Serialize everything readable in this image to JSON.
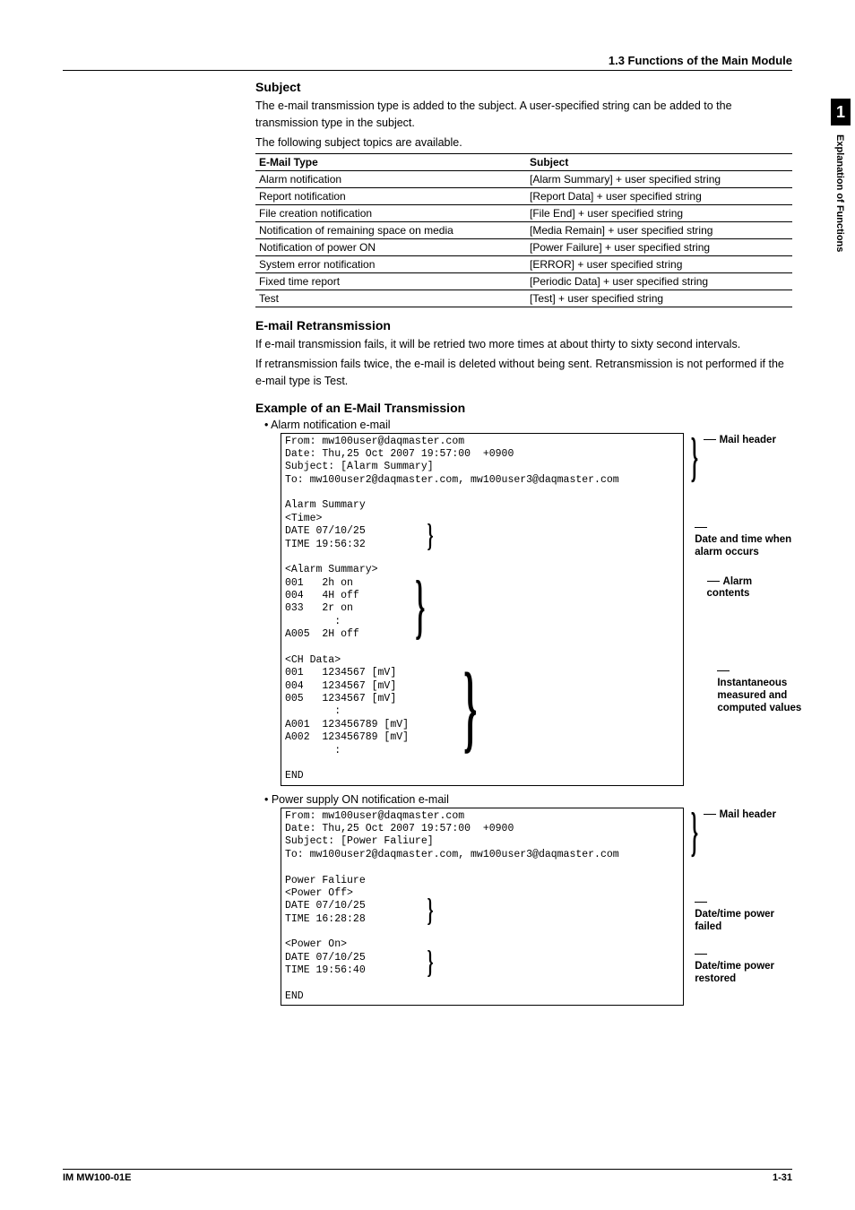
{
  "header": {
    "section": "1.3  Functions of the Main Module"
  },
  "sidetab": {
    "num": "1",
    "label": "Explanation of Functions"
  },
  "subject": {
    "title": "Subject",
    "p1": "The e-mail transmission type is added to the subject. A user-specified string can be added to the transmission type in the subject.",
    "p2": "The following subject topics are available.",
    "th1": "E-Mail Type",
    "th2": "Subject",
    "rows": [
      {
        "c1": "Alarm notification",
        "c2": "[Alarm Summary] + user specified string"
      },
      {
        "c1": "Report notification",
        "c2": "[Report Data] + user specified string"
      },
      {
        "c1": "File creation notification",
        "c2": "[File End] + user specified string"
      },
      {
        "c1": "Notification of remaining space on media",
        "c2": "[Media Remain] + user specified string"
      },
      {
        "c1": "Notification of power ON",
        "c2": "[Power Failure] + user specified string"
      },
      {
        "c1": "System error notification",
        "c2": "[ERROR] + user specified string"
      },
      {
        "c1": "Fixed time report",
        "c2": "[Periodic Data] + user specified string"
      },
      {
        "c1": "Test",
        "c2": "[Test] + user specified string"
      }
    ]
  },
  "retrans": {
    "title": "E-mail Retransmission",
    "p1": "If e-mail transmission fails, it will be retried two more times at about thirty to sixty second intervals.",
    "p2": "If retransmission fails twice, the e-mail is deleted without being sent. Retransmission is not performed if the e-mail type is Test."
  },
  "example": {
    "title": "Example of an E-Mail Transmission",
    "bullet1": "•  Alarm notification e-mail",
    "bullet2": "•  Power supply ON notification e-mail"
  },
  "email1": {
    "text": "From: mw100user@daqmaster.com\nDate: Thu,25 Oct 2007 19:57:00  +0900\nSubject: [Alarm Summary]\nTo: mw100user2@daqmaster.com, mw100user3@daqmaster.com\n\nAlarm Summary\n<Time>\nDATE 07/10/25\nTIME 19:56:32\n\n<Alarm Summary>\n001   2h on\n004   4H off\n033   2r on\n        :\nA005  2H off\n\n<CH Data>\n001   1234567 [mV]\n004   1234567 [mV]\n005   1234567 [mV]\n        :\nA001  123456789 [mV]\nA002  123456789 [mV]\n        :\n\nEND",
    "a1": "Mail header",
    "a2": "Date and time when alarm occurs",
    "a3": "Alarm contents",
    "a4": "Instantaneous measured and computed values"
  },
  "email2": {
    "text": "From: mw100user@daqmaster.com\nDate: Thu,25 Oct 2007 19:57:00  +0900\nSubject: [Power Faliure]\nTo: mw100user2@daqmaster.com, mw100user3@daqmaster.com\n\nPower Faliure\n<Power Off>\nDATE 07/10/25\nTIME 16:28:28\n\n<Power On>\nDATE 07/10/25\nTIME 19:56:40\n\nEND",
    "a1": "Mail header",
    "a2": "Date/time power failed",
    "a3": "Date/time power restored"
  },
  "footer": {
    "left": "IM MW100-01E",
    "right": "1-31"
  }
}
